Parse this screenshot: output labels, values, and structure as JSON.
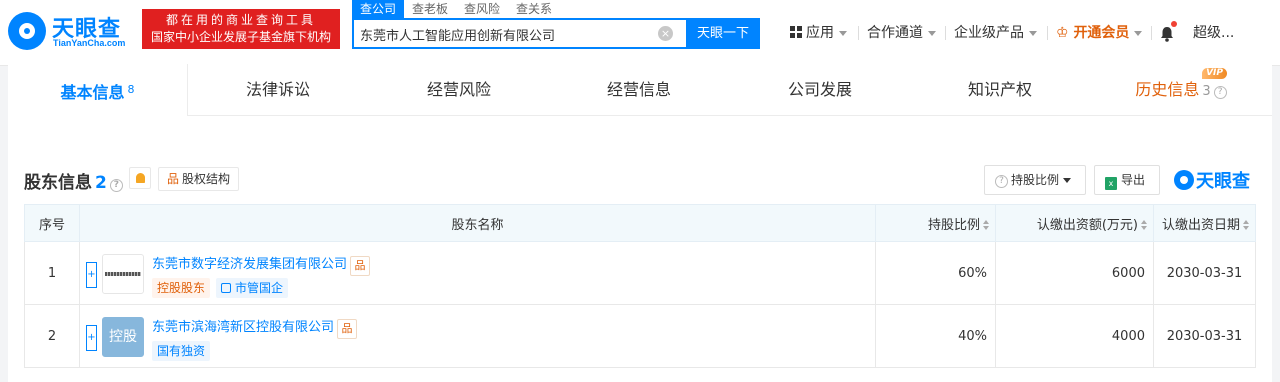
{
  "header": {
    "logo_cn": "天眼查",
    "logo_en": "TianYanCha.com",
    "promo_line1": "都在用的商业查询工具",
    "promo_line2": "国家中小企业发展子基金旗下机构",
    "search_tabs": [
      "查公司",
      "查老板",
      "查风险",
      "查关系"
    ],
    "search_value": "东莞市人工智能应用创新有限公司",
    "search_button": "天眼一下",
    "clear_icon": "clear-icon",
    "nav_apps": "应用",
    "nav_channel": "合作通道",
    "nav_enterprise": "企业级产品",
    "nav_vip": "开通会员",
    "nav_user": "超级..."
  },
  "tabs": {
    "basic": "基本信息",
    "basic_count": "8",
    "legal": "法律诉讼",
    "risk": "经营风险",
    "ops": "经营信息",
    "dev": "公司发展",
    "ip": "知识产权",
    "history": "历史信息",
    "history_count": "3",
    "vip_badge": "VIP"
  },
  "section": {
    "title": "股东信息",
    "count": "2",
    "structure_button": "股权结构",
    "ratio_button": "持股比例",
    "export_button": "导出",
    "brand": "天眼查"
  },
  "table": {
    "headers": {
      "index": "序号",
      "name": "股东名称",
      "ratio": "持股比例",
      "amount": "认缴出资额(万元)",
      "date": "认缴出资日期"
    },
    "rows": [
      {
        "index": "1",
        "name": "东莞市数字经济发展集团有限公司",
        "tags": [
          "控股股东",
          "市管国企"
        ],
        "ratio": "60%",
        "amount": "6000",
        "date": "2030-03-31"
      },
      {
        "index": "2",
        "name": "东莞市滨海湾新区控股有限公司",
        "logo_text": "控股",
        "tags": [
          "国有独资"
        ],
        "ratio": "40%",
        "amount": "4000",
        "date": "2030-03-31"
      }
    ]
  },
  "colors": {
    "brand_blue": "#0084ff",
    "promo_red": "#e02020",
    "accent_orange": "#e0610c"
  }
}
